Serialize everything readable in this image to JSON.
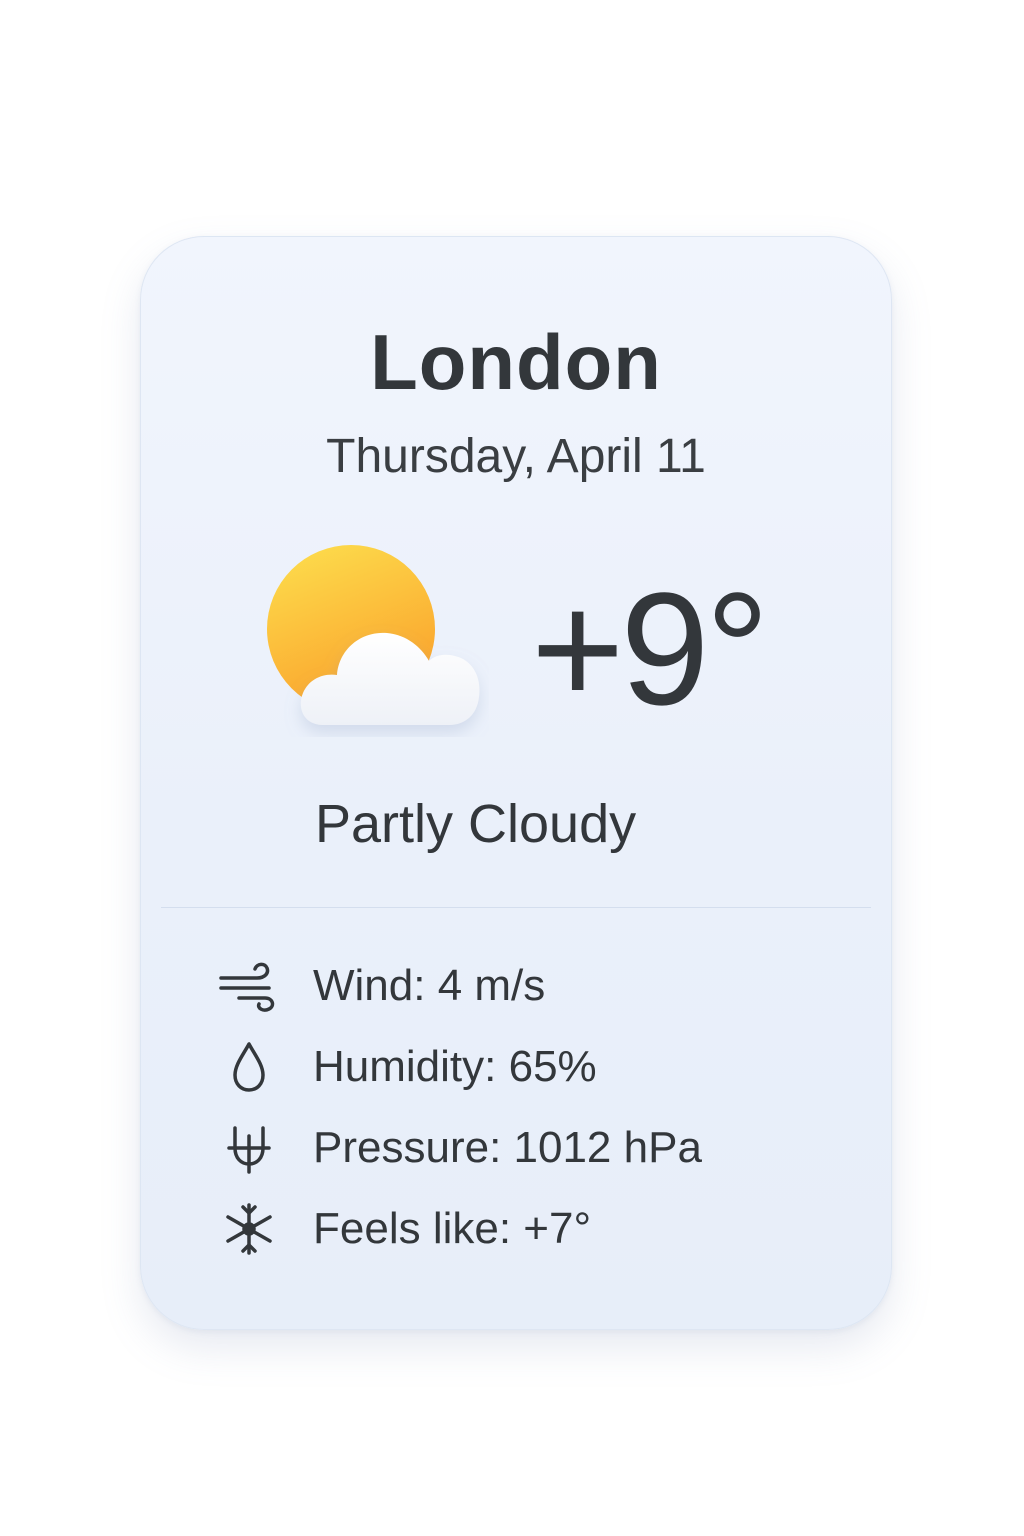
{
  "weather": {
    "city": "London",
    "date": "Thursday, April 11",
    "temperature": "+9°",
    "condition": "Partly Cloudy",
    "condition_icon": "partly-cloudy-icon",
    "details": [
      {
        "icon": "wind-icon",
        "label": "Wind: 4 m/s"
      },
      {
        "icon": "humidity-icon",
        "label": "Humidity: 65%"
      },
      {
        "icon": "pressure-icon",
        "label": "Pressure: 1012 hPa"
      },
      {
        "icon": "feels-like-icon",
        "label": "Feels like: +7°"
      }
    ]
  },
  "colors": {
    "card_background": "#eef3fc",
    "text": "#33373b",
    "sun_light": "#fdd94a",
    "sun_dark": "#fba22c",
    "cloud": "#ffffff"
  }
}
